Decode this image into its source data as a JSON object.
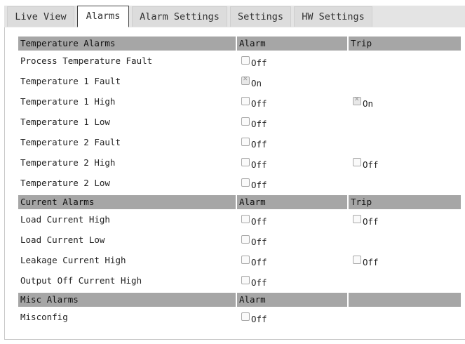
{
  "tabs": [
    "Live View",
    "Alarms",
    "Alarm Settings",
    "Settings",
    "HW Settings"
  ],
  "active_tab": "Alarms",
  "sections": [
    {
      "title": "Temperature Alarms",
      "col_alarm": "Alarm",
      "col_trip": "Trip",
      "rows": [
        {
          "name": "Process Temperature Fault",
          "alarm": "Off",
          "alarm_checked": false
        },
        {
          "name": "Temperature 1 Fault",
          "alarm": "On",
          "alarm_checked": true
        },
        {
          "name": "Temperature 1 High",
          "alarm": "Off",
          "alarm_checked": false,
          "trip": "On",
          "trip_checked": true
        },
        {
          "name": "Temperature 1 Low",
          "alarm": "Off",
          "alarm_checked": false
        },
        {
          "name": "Temperature 2 Fault",
          "alarm": "Off",
          "alarm_checked": false
        },
        {
          "name": "Temperature 2 High",
          "alarm": "Off",
          "alarm_checked": false,
          "trip": "Off",
          "trip_checked": false
        },
        {
          "name": "Temperature 2 Low",
          "alarm": "Off",
          "alarm_checked": false
        }
      ]
    },
    {
      "title": "Current Alarms",
      "col_alarm": "Alarm",
      "col_trip": "Trip",
      "rows": [
        {
          "name": "Load Current High",
          "alarm": "Off",
          "alarm_checked": false,
          "trip": "Off",
          "trip_checked": false
        },
        {
          "name": "Load Current Low",
          "alarm": "Off",
          "alarm_checked": false
        },
        {
          "name": "Leakage Current High",
          "alarm": "Off",
          "alarm_checked": false,
          "trip": "Off",
          "trip_checked": false
        },
        {
          "name": "Output Off Current High",
          "alarm": "Off",
          "alarm_checked": false
        }
      ]
    },
    {
      "title": "Misc Alarms",
      "col_alarm": "Alarm",
      "col_trip": "",
      "rows": [
        {
          "name": "Misconfig",
          "alarm": "Off",
          "alarm_checked": false
        }
      ]
    }
  ]
}
